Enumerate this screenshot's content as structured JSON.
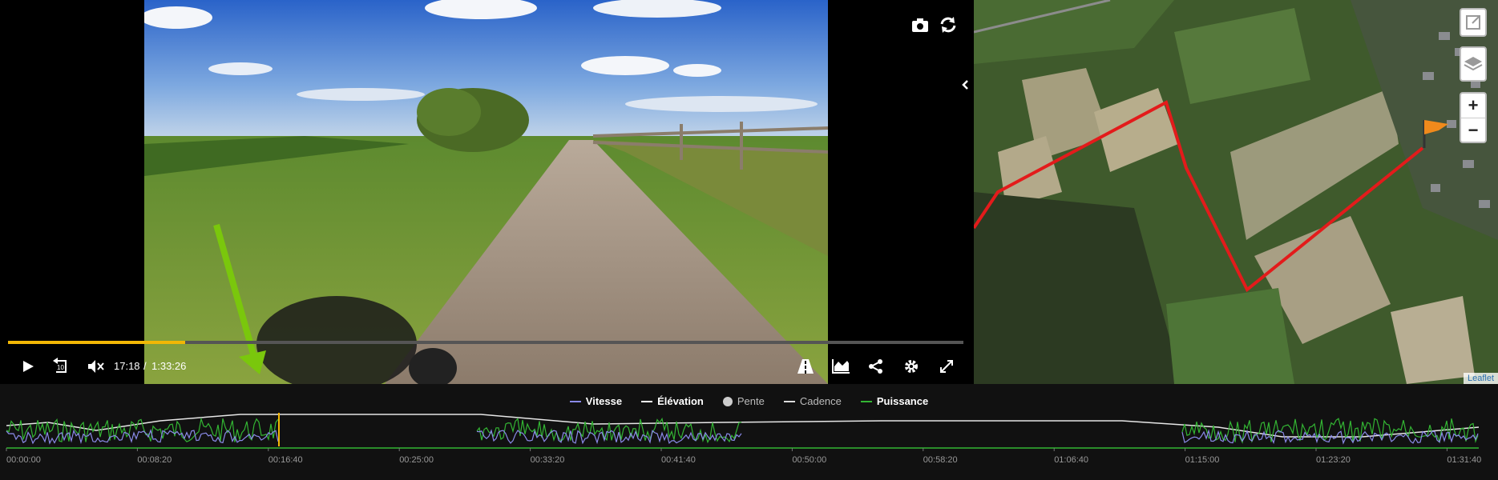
{
  "player": {
    "current_time": "17:18",
    "separator": "/",
    "duration": "1:33:26",
    "progress": 0.185,
    "replay_seconds": "10",
    "colors": {
      "progress": "#f2b705",
      "arrow": "#7ac70c"
    },
    "icons": [
      "play-icon",
      "replay-10-icon",
      "mute-icon",
      "camera-icon",
      "sync-icon",
      "road-icon",
      "chart-icon",
      "share-icon",
      "gear-icon",
      "fullscreen-icon",
      "chevron-left-icon"
    ]
  },
  "map": {
    "attribution": "Leaflet",
    "zoom_in": "+",
    "zoom_out": "−",
    "route_color": "#e31b1b",
    "flag_color": "#f08a1c"
  },
  "graph": {
    "legend": [
      {
        "label": "Vitesse",
        "color": "#8a8ae8",
        "muted": false
      },
      {
        "label": "Élévation",
        "color": "#ffffff",
        "muted": false
      },
      {
        "label": "Pente",
        "color": "#cccccc",
        "muted": true
      },
      {
        "label": "Cadence",
        "color": "#dddddd",
        "muted": true
      },
      {
        "label": "Puissance",
        "color": "#33b533",
        "muted": false
      }
    ],
    "ticks": [
      "00:00:00",
      "00:08:20",
      "00:16:40",
      "00:25:00",
      "00:33:20",
      "00:41:40",
      "00:50:00",
      "00:58:20",
      "01:06:40",
      "01:15:00",
      "01:23:20",
      "01:31:40"
    ]
  }
}
